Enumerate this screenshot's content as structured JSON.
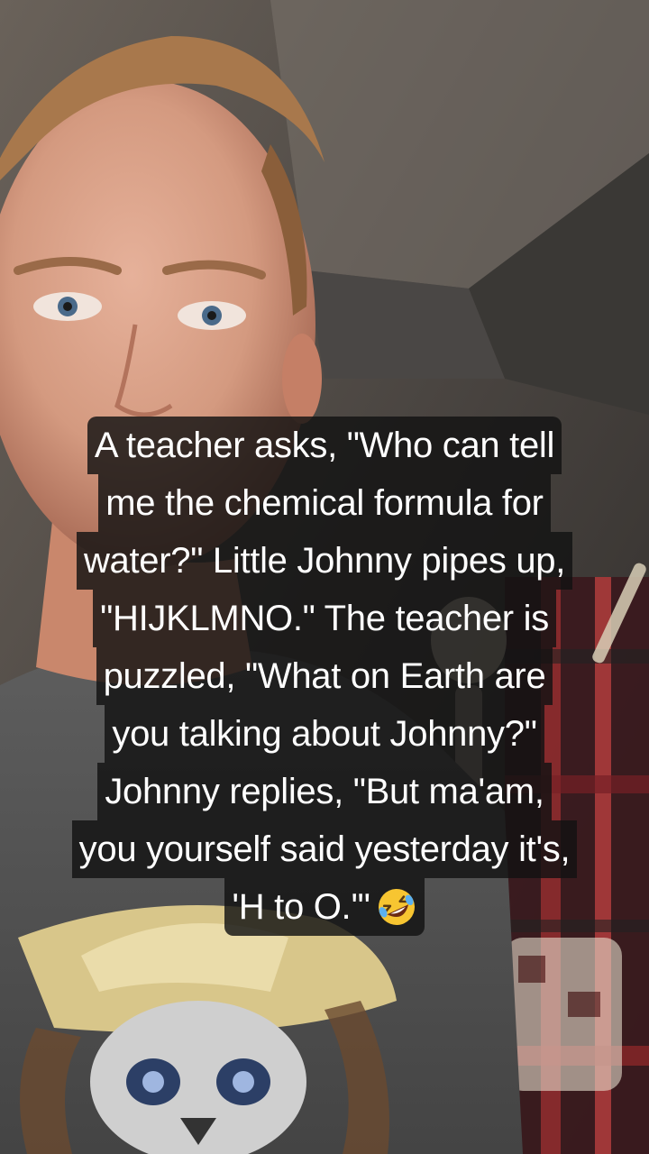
{
  "caption": {
    "lines": [
      "A teacher asks, \"Who can tell",
      "me the chemical formula for",
      "water?\" Little Johnny pipes up,",
      "\"HIJKLMNO.\" The teacher is",
      "puzzled, \"What on Earth are",
      "you talking about Johnny?\"",
      "Johnny replies, \"But ma'am,",
      "you yourself said yesterday it's,",
      "'H to O.'\""
    ],
    "emoji": "rolling-on-floor-laughing-icon"
  },
  "colors": {
    "caption_bg": "#121212",
    "caption_text": "#ffffff"
  }
}
